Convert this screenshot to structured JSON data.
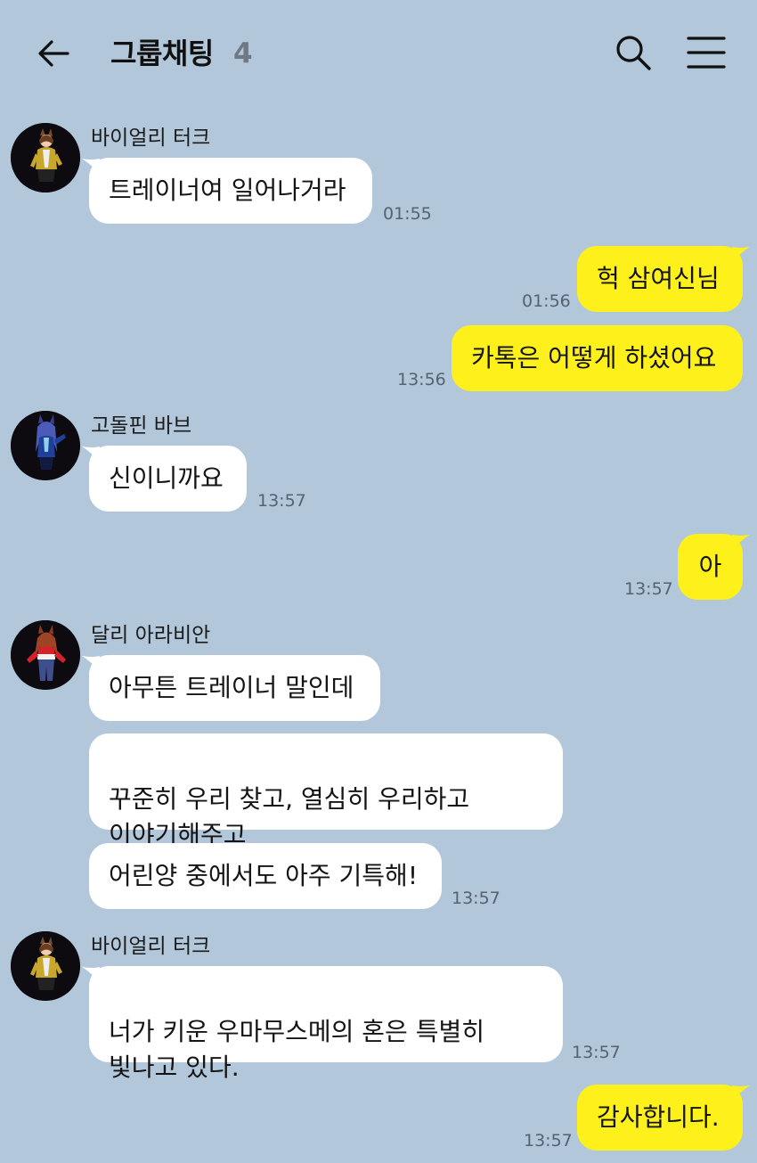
{
  "header": {
    "title": "그룹채팅",
    "member_count": "4"
  },
  "messages": {
    "m1": {
      "sender": "바이얼리 터크",
      "text": "트레이너여 일어나거라",
      "time": "01:55"
    },
    "m2": {
      "text": "헉 삼여신님",
      "time": "01:56"
    },
    "m3": {
      "text": "카톡은 어떻게 하셨어요",
      "time": "13:56"
    },
    "m4": {
      "sender": "고돌핀 바브",
      "text": "신이니까요",
      "time": "13:57"
    },
    "m5": {
      "text": "아",
      "time": "13:57"
    },
    "m6": {
      "sender": "달리 아라비안",
      "text": "아무튼 트레이너 말인데"
    },
    "m7": {
      "text": "꾸준히 우리 찾고, 열심히 우리하고\n이야기해주고"
    },
    "m8": {
      "text": "어린양 중에서도 아주 기특해!",
      "time": "13:57"
    },
    "m9": {
      "sender": "바이얼리 터크",
      "text": "너가 키운 우마무스메의 혼은 특별히\n빛나고 있다.",
      "time": "13:57"
    },
    "m10": {
      "text": "감사합니다.",
      "time": "13:57"
    }
  },
  "colors": {
    "background": "#b2c7da",
    "incoming_bubble": "#ffffff",
    "outgoing_bubble": "#fef01b"
  },
  "icons": [
    "back-arrow-icon",
    "search-icon",
    "hamburger-menu-icon"
  ]
}
